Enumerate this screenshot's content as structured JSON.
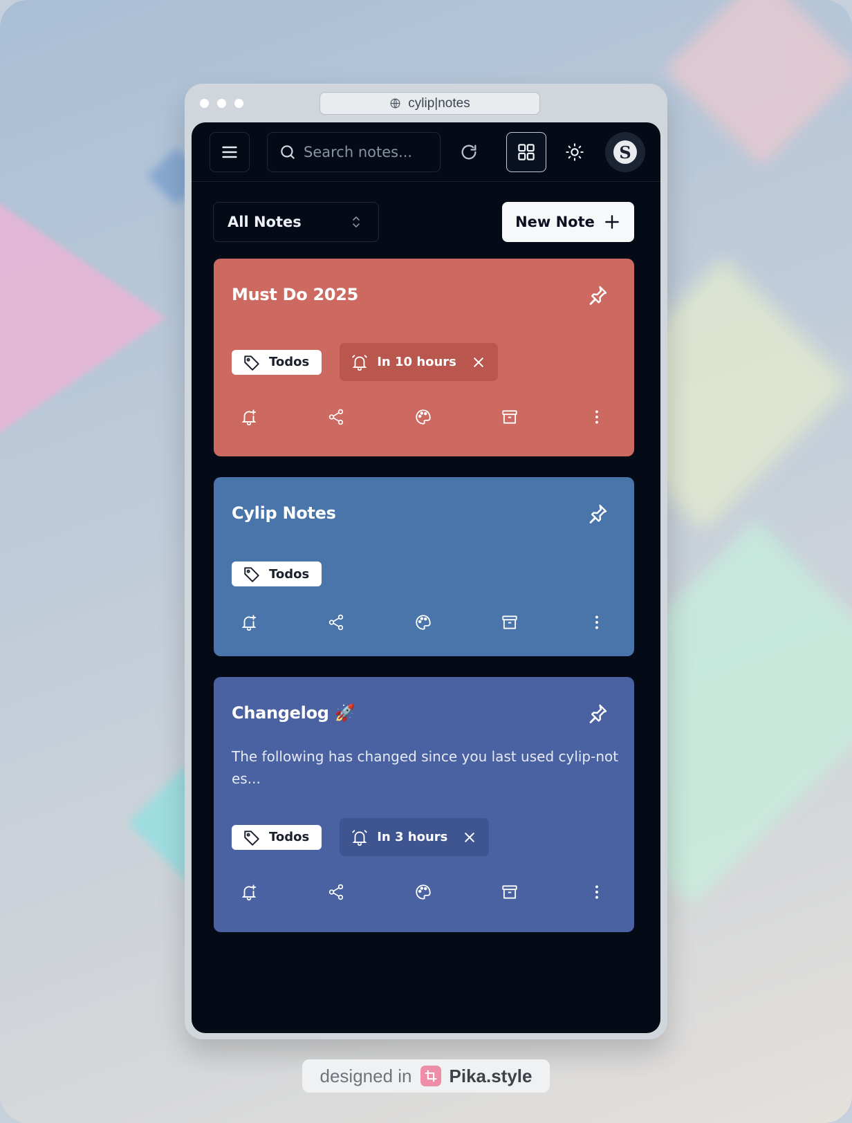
{
  "browser": {
    "url": "cylip|notes"
  },
  "header": {
    "search_placeholder": "Search notes...",
    "avatar_letter": "S"
  },
  "toolbar": {
    "filter_selected": "All Notes",
    "new_note_label": "New Note"
  },
  "notes": [
    {
      "title": "Must Do 2025",
      "body": "",
      "tag": "Todos",
      "reminder": "In 10 hours",
      "color": "#cc6a62",
      "chip_color": "#b9574f"
    },
    {
      "title": "Cylip Notes",
      "body": "",
      "tag": "Todos",
      "reminder": "",
      "color": "#4a75aa",
      "chip_color": ""
    },
    {
      "title": "Changelog 🚀",
      "body": "The following has changed since you last used cylip-not es...",
      "tag": "Todos",
      "reminder": "In 3 hours",
      "color": "#4a62a1",
      "chip_color": "#3f5590"
    }
  ],
  "icons": [
    "menu-icon",
    "search-icon",
    "refresh-icon",
    "grid-view-icon",
    "sun-icon",
    "pin-icon",
    "tag-icon",
    "bell-icon",
    "close-icon",
    "bell-plus-icon",
    "share-icon",
    "palette-icon",
    "archive-icon",
    "more-vertical-icon",
    "globe-icon",
    "chevron-up-down-icon",
    "plus-icon"
  ],
  "credit": {
    "prefix": "designed in",
    "brand": "Pika.style"
  }
}
